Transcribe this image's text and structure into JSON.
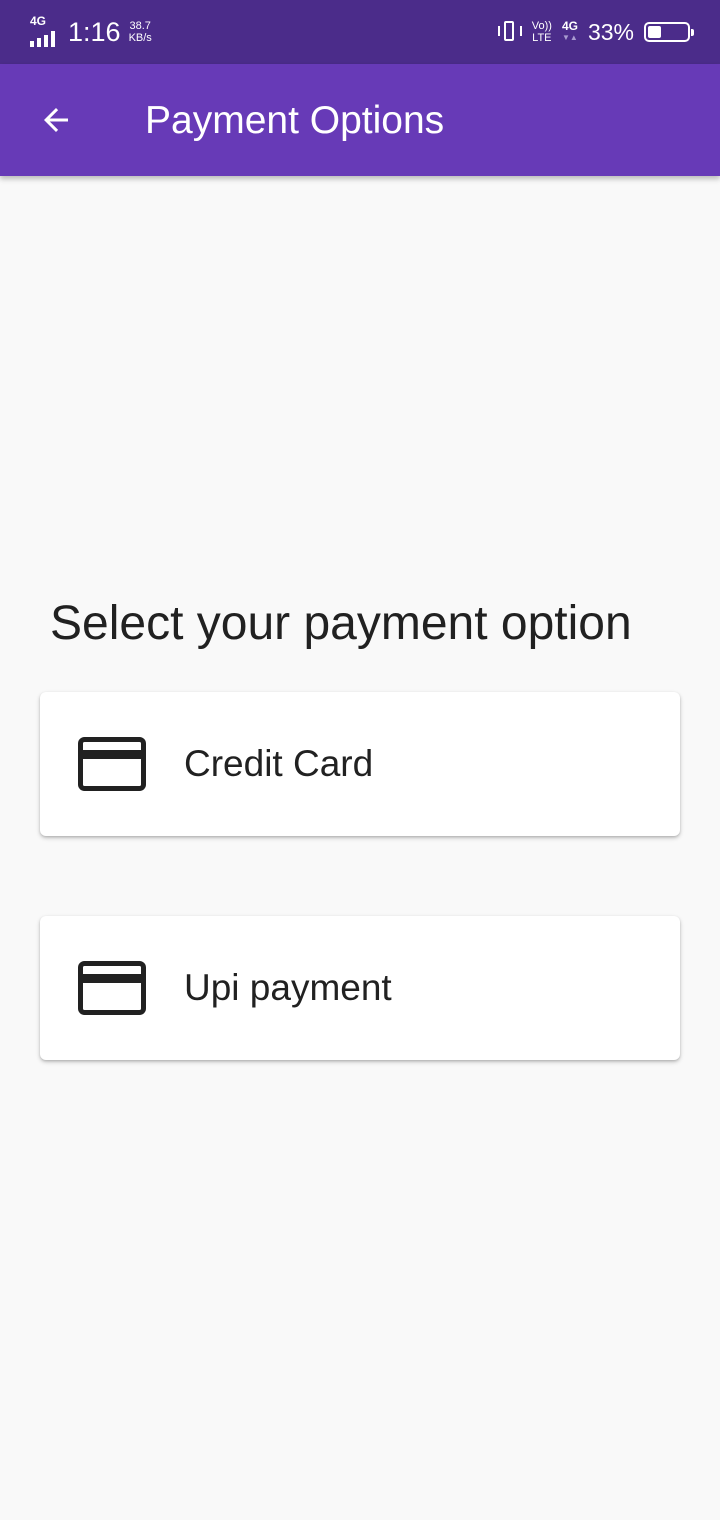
{
  "status_bar": {
    "network": "4G",
    "time": "1:16",
    "speed_value": "38.7",
    "speed_unit": "KB/s",
    "volte_top": "Vo))",
    "volte_bottom": "LTE",
    "data_network": "4G",
    "battery_percent": "33%",
    "battery_level": 0.33
  },
  "app_bar": {
    "title": "Payment Options",
    "back_icon": "arrow-back-icon",
    "background": "#673ab7",
    "status_background": "#4b2c8a"
  },
  "main": {
    "prompt": "Select your payment option",
    "options": [
      {
        "label": "Credit Card",
        "icon": "credit-card-icon"
      },
      {
        "label": "Upi payment",
        "icon": "credit-card-icon"
      }
    ]
  }
}
